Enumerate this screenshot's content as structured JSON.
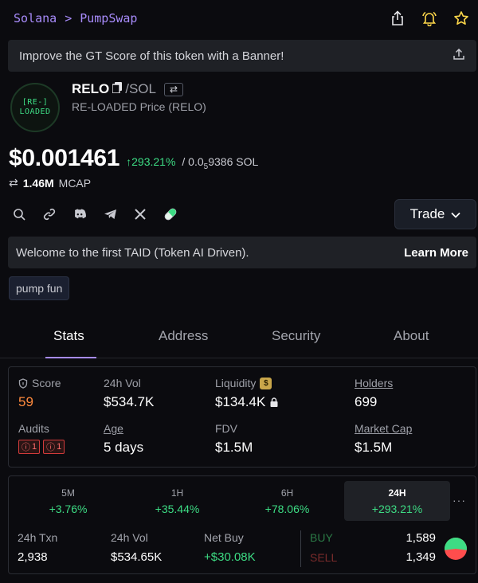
{
  "breadcrumb": {
    "chain": "Solana",
    "separator": ">",
    "dex": "PumpSwap"
  },
  "banner": {
    "text": "Improve the GT Score of this token with a Banner!"
  },
  "token": {
    "logo_line1": "[RE-]",
    "logo_line2": "LOADED",
    "symbol": "RELO",
    "pair": "/SOL",
    "subtitle": "RE-LOADED Price (RELO)",
    "price": "$0.001461",
    "change": "293.21%",
    "sol_prefix": "/ 0.0",
    "sol_sub": "5",
    "sol_rest": "9386 SOL",
    "mcap_value": "1.46M",
    "mcap_label": "MCAP"
  },
  "trade_button": {
    "label": "Trade"
  },
  "taid": {
    "text": "Welcome to the first TAID (Token AI Driven).",
    "link": "Learn More"
  },
  "tag": {
    "label": "pump fun"
  },
  "tabs": {
    "stats": "Stats",
    "address": "Address",
    "security": "Security",
    "about": "About"
  },
  "stats": {
    "score_label": "Score",
    "score_value": "59",
    "vol_label": "24h Vol",
    "vol_value": "$534.7K",
    "liq_label": "Liquidity",
    "liq_value": "$134.4K",
    "holders_label": "Holders",
    "holders_value": "699",
    "audits_label": "Audits",
    "audit1": "1",
    "audit2": "1",
    "age_label": "Age",
    "age_value": "5 days",
    "fdv_label": "FDV",
    "fdv_value": "$1.5M",
    "mcap_label": "Market Cap",
    "mcap_value": "$1.5M"
  },
  "performance": {
    "periods": [
      {
        "label": "5M",
        "value": "+3.76%"
      },
      {
        "label": "1H",
        "value": "+35.44%"
      },
      {
        "label": "6H",
        "value": "+78.06%"
      },
      {
        "label": "24H",
        "value": "+293.21%"
      }
    ],
    "more": "···",
    "txn_label": "24h Txn",
    "txn_value": "2,938",
    "vol_label": "24h Vol",
    "vol_value": "$534.65K",
    "netbuy_label": "Net Buy",
    "netbuy_value": "+$30.08K",
    "buy_label": "BUY",
    "buy_value": "1,589",
    "sell_label": "SELL",
    "sell_value": "1,349",
    "buy_fraction": 0.541
  },
  "colors": {
    "accent": "#a78bfa",
    "green": "#3ddc84",
    "red": "#ff4d4d",
    "orange": "#ff8a3d"
  }
}
